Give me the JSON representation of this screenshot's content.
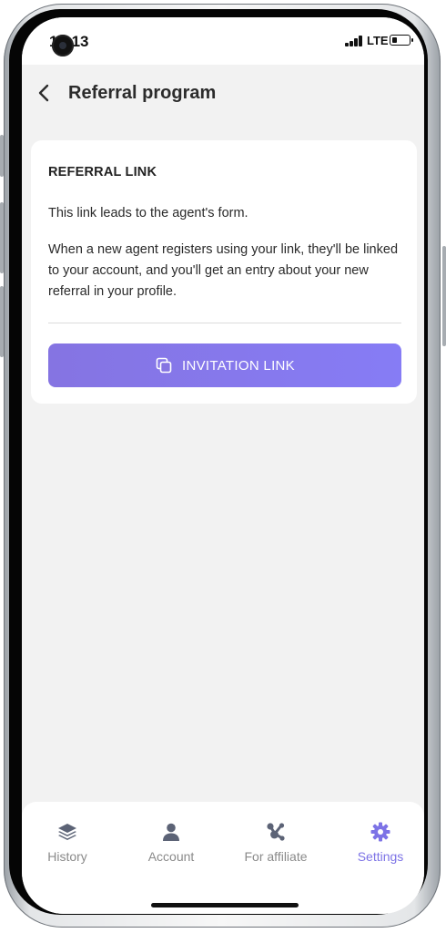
{
  "status_bar": {
    "time": "10:13",
    "network": "LTE",
    "battery_level": 0.35
  },
  "header": {
    "back_icon": "chevron-left-icon",
    "title": "Referral program"
  },
  "card": {
    "title": "REFERRAL LINK",
    "paragraph_1": "This link leads to the agent's form.",
    "paragraph_2": "When a new agent registers using your link, they'll be linked to your account, and you'll get an entry about your new referral in your profile.",
    "button_label": "INVITATION LINK",
    "button_icon": "copy-icon"
  },
  "tabs": [
    {
      "label": "History",
      "icon": "layers-icon",
      "active": false
    },
    {
      "label": "Account",
      "icon": "person-icon",
      "active": false
    },
    {
      "label": "For affiliate",
      "icon": "network-icon",
      "active": false
    },
    {
      "label": "Settings",
      "icon": "gear-icon",
      "active": true
    }
  ],
  "colors": {
    "accent": "#7D73E6",
    "button_gradient_start": "#8574E2",
    "button_gradient_end": "#867CF5",
    "inactive_tab": "#8A8A8A",
    "inactive_icon": "#5C6376",
    "background": "#F2F2F2"
  }
}
